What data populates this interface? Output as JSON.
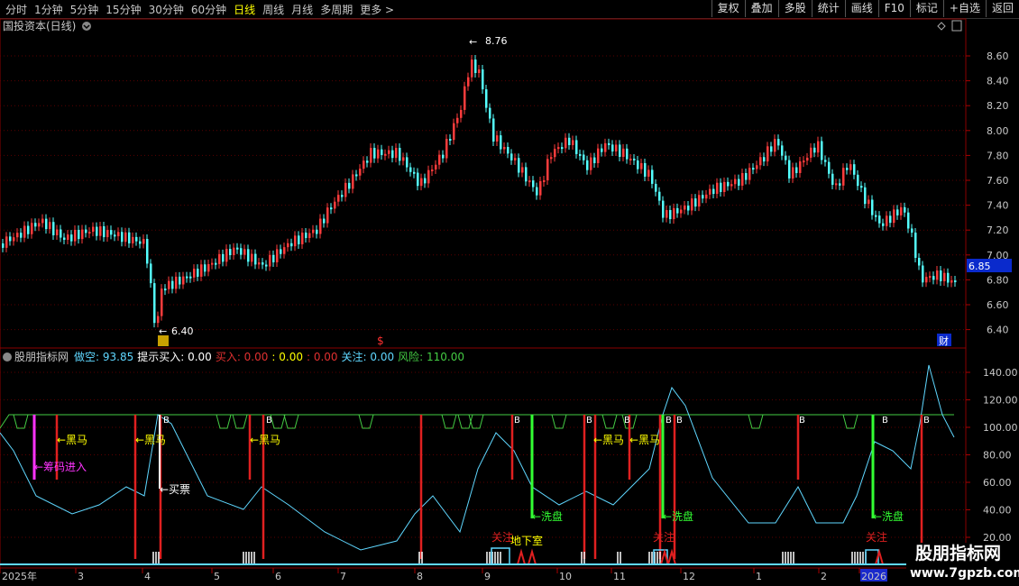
{
  "toolbar": {
    "periods": [
      "分时",
      "1分钟",
      "5分钟",
      "15分钟",
      "30分钟",
      "60分钟",
      "日线",
      "周线",
      "月线",
      "多周期",
      "更多 >"
    ],
    "active": "日线",
    "buttons": [
      "复权",
      "叠加",
      "多股",
      "统计",
      "画线",
      "F10",
      "标记",
      "+自选",
      "返回"
    ]
  },
  "main_panel": {
    "title": "国投资本(日线)",
    "price_axis": [
      "8.60",
      "8.40",
      "8.20",
      "8.00",
      "7.80",
      "7.60",
      "7.40",
      "7.20",
      "7.00",
      "6.80",
      "6.60",
      "6.40"
    ],
    "current_price": "6.85",
    "high_label": "8.76",
    "low_label": "6.40",
    "markers": {
      "dividend": "$",
      "finance": "财"
    }
  },
  "indicator_panel": {
    "name": "股朋指标网",
    "values": [
      {
        "label": "做空:",
        "value": "93.85",
        "color": "#5fd7ff"
      },
      {
        "label": "提示买入:",
        "value": "0.00",
        "color": "#ffffff"
      },
      {
        "label": "买入:",
        "value": "0.00",
        "color": "#e03030"
      },
      {
        "label": ":",
        "value": "0.00",
        "color": "#ffff00"
      },
      {
        "label": ":",
        "value": "0.00",
        "color": "#e03030"
      },
      {
        "label": "关注:",
        "value": "0.00",
        "color": "#5fd7ff"
      },
      {
        "label": "风险:",
        "value": "110.00",
        "color": "#44cc44"
      }
    ],
    "axis": [
      "140.00",
      "120.00",
      "100.00",
      "80.00",
      "60.00",
      "40.00",
      "20.00"
    ],
    "signals": {
      "heima": "←黑马",
      "chouma": "←筹码进入",
      "maipiao": "←买票",
      "xipan": "←洗盘",
      "guanzhu": "关注",
      "dixiashi": "地下室",
      "b": "B"
    }
  },
  "x_axis": {
    "labels": [
      "2025年",
      "3",
      "4",
      "5",
      "6",
      "7",
      "8",
      "9",
      "10",
      "11",
      "12",
      "1",
      "2",
      "2026"
    ]
  },
  "watermark": {
    "title": "股朋指标网",
    "url": "www.7gpzb.com"
  },
  "colors": {
    "up": "#ff3c3c",
    "down": "#54ffff",
    "grid": "#7a0000",
    "text": "#c8c8c8"
  }
}
